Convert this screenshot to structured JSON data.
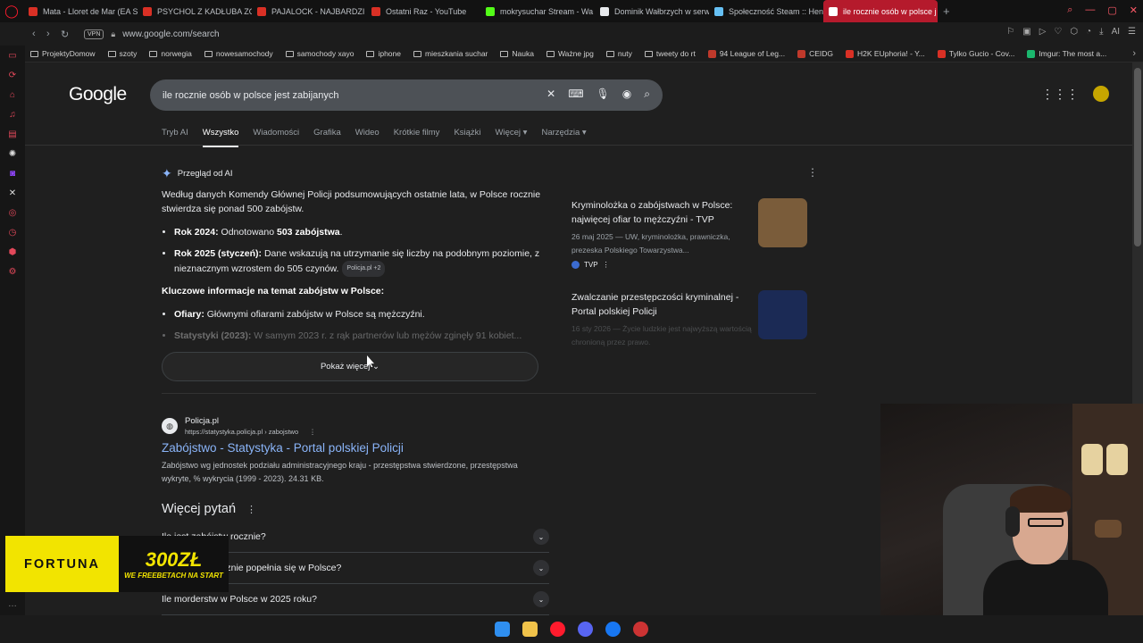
{
  "browser": {
    "tabs": [
      {
        "label": "Mata - Lloret de Mar (EA S",
        "color": "#d93025"
      },
      {
        "label": "PSYCHOL Z KADŁUBA ZO",
        "color": "#d93025"
      },
      {
        "label": "PAJALOCK - NAJBARDZI",
        "color": "#d93025"
      },
      {
        "label": "Ostatni Raz - YouTube",
        "color": "#d93025"
      },
      {
        "label": "mokrysuchar Stream - Wa",
        "color": "#53fc18"
      },
      {
        "label": "Dominik Wałbrzych w serw",
        "color": "#e8eaed"
      },
      {
        "label": "Społeczność Steam :: Hen",
        "color": "#66c0f4"
      },
      {
        "label": "ile rocznie osób w polsce j",
        "color": "#ffffff"
      }
    ],
    "active_tab": 7,
    "new_tab_icon": "plus-icon",
    "vpn_label": "VPN",
    "url": "www.google.com/search",
    "ai_label": "AI",
    "bookmarks": [
      {
        "label": "ProjektyDomow",
        "type": "folder"
      },
      {
        "label": "szoty",
        "type": "folder"
      },
      {
        "label": "norwegia",
        "type": "folder"
      },
      {
        "label": "nowesamochody",
        "type": "folder"
      },
      {
        "label": "samochody xayo",
        "type": "folder"
      },
      {
        "label": "iphone",
        "type": "folder"
      },
      {
        "label": "mieszkania suchar",
        "type": "folder"
      },
      {
        "label": "Nauka",
        "type": "folder"
      },
      {
        "label": "Ważne jpg",
        "type": "folder"
      },
      {
        "label": "nuty",
        "type": "folder"
      },
      {
        "label": "tweety do rt",
        "type": "folder"
      },
      {
        "label": "94 League of Leg...",
        "type": "site",
        "color": "#c0392b"
      },
      {
        "label": "CEIDG",
        "type": "site",
        "color": "#c0392b"
      },
      {
        "label": "H2K EUphoria! - Y...",
        "type": "site",
        "color": "#d93025"
      },
      {
        "label": "Tylko Gucio - Cov...",
        "type": "site",
        "color": "#d93025"
      },
      {
        "label": "Imgur: The most a...",
        "type": "site",
        "color": "#1bb76e"
      }
    ]
  },
  "google": {
    "logo": "Google",
    "query": "ile rocznie osób w polsce jest zabijanych",
    "tabs": [
      "Tryb AI",
      "Wszystko",
      "Wiadomości",
      "Grafika",
      "Wideo",
      "Krótkie filmy",
      "Książki",
      "Więcej ▾",
      "Narzędzia ▾"
    ],
    "active_tab": 1,
    "ai_overview": {
      "heading": "Przegląd od AI",
      "intro": "Według danych Komendy Głównej Policji podsumowujących ostatnie lata, w Polsce rocznie stwierdza się ponad 500 zabójstw.",
      "bullets": [
        {
          "bold": "Rok 2024:",
          "text": " Odnotowano ",
          "bold2": "503 zabójstwa",
          "tail": "."
        },
        {
          "bold": "Rok 2025 (styczeń):",
          "text": " Dane wskazują na utrzymanie się liczby na podobnym poziomie, z nieznacznym wzrostem do 505 czynów.",
          "chip": "Policja.pl +2"
        }
      ],
      "subheading": "Kluczowe informacje na temat zabójstw w Polsce:",
      "key_bullets": [
        {
          "bold": "Ofiary:",
          "text": " Głównymi ofiarami zabójstw w Polsce są mężczyźni."
        },
        {
          "bold": "Statystyki (2023):",
          "text": " W samym 2023 r. z rąk partnerów lub mężów zginęły 91 kobiet..."
        }
      ],
      "show_more": "Pokaż więcej ⌄",
      "sources": [
        {
          "title": "Kryminolożka o zabójstwach w Polsce: najwięcej ofiar to mężczyźni - TVP",
          "meta": "26 maj 2025 — UW, kryminolożka, prawniczka, prezeska Polskiego Towarzystwa...",
          "site": "TVP",
          "thumb_color": "#7a5c3a"
        },
        {
          "title": "Zwalczanie przestępczości kryminalnej - Portal polskiej Policji",
          "meta": "16 sty 2026 — Życie ludzkie jest najwyższą wartością chronioną przez prawo.",
          "site": "",
          "thumb_color": "#1b2a55"
        }
      ]
    },
    "result": {
      "site": "Policja.pl",
      "url": "https://statystyka.policja.pl › zabojstwo",
      "title": "Zabójstwo - Statystyka - Portal polskiej Policji",
      "snippet": "Zabójstwo wg jednostek podziału administracyjnego kraju - przestępstwa stwierdzone, przestępstwa wykryte, % wykrycia (1999 - 2023). 24.31 KB."
    },
    "people_also_ask": {
      "title": "Więcej pytań",
      "questions": [
        "Ile jest zabójstw rocznie?",
        "Ile zabójstw rocznie popełnia się w Polsce?",
        "Ile morderstw w Polsce w 2025 roku?"
      ]
    }
  },
  "overlay": {
    "brand": "FORTUNA",
    "amount": "300ZŁ",
    "promo": "WE FREEBETACH NA START"
  }
}
